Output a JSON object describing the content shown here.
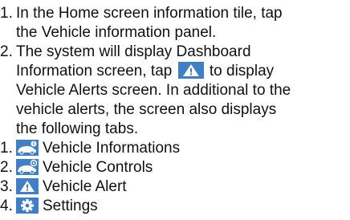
{
  "steps": [
    {
      "number": "1.",
      "lines": [
        "In the Home screen information tile, tap",
        "the Vehicle information panel."
      ]
    },
    {
      "number": "2.",
      "line1": "The system will display Dashboard",
      "line2_before": "Information screen, tap",
      "line2_after": "to display",
      "line3": "Vehicle Alerts screen. In additional to the",
      "line4": "vehicle alerts, the screen also displays",
      "line5": "the following tabs."
    }
  ],
  "tabs": [
    {
      "number": "1.",
      "label": "Vehicle Informations",
      "icon": "car-info-icon"
    },
    {
      "number": "2.",
      "label": "Vehicle Controls",
      "icon": "car-controls-icon"
    },
    {
      "number": "3.",
      "label": "Vehicle Alert",
      "icon": "warning-icon"
    },
    {
      "number": "4.",
      "label": "Settings",
      "icon": "gear-icon"
    }
  ],
  "colors": {
    "icon_bg": "#3f7fc6",
    "warning_fill": "#ffffff",
    "text": "#111111"
  }
}
